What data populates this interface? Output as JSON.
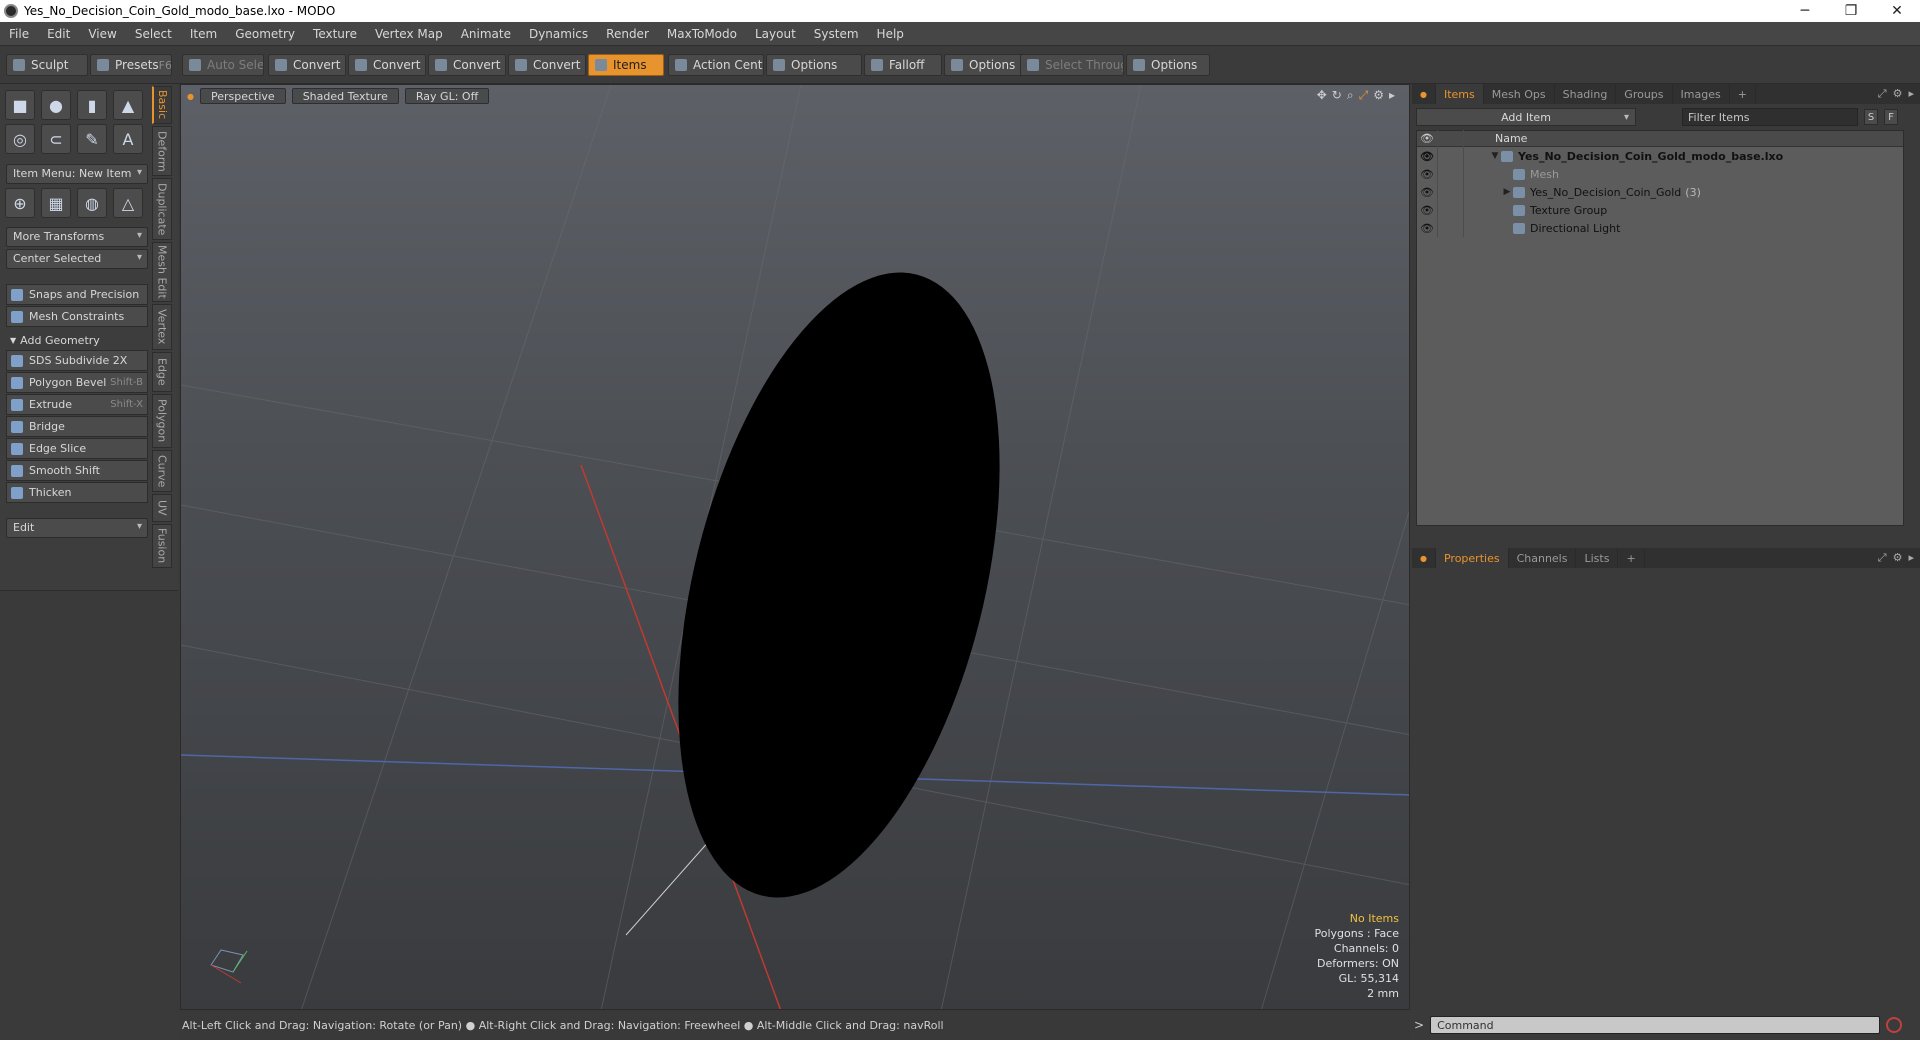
{
  "window": {
    "title": "Yes_No_Decision_Coin_Gold_modo_base.lxo - MODO"
  },
  "menu": [
    "File",
    "Edit",
    "View",
    "Select",
    "Item",
    "Geometry",
    "Texture",
    "Vertex Map",
    "Animate",
    "Dynamics",
    "Render",
    "MaxToModo",
    "Layout",
    "System",
    "Help"
  ],
  "toolbar": {
    "sculpt": "Sculpt",
    "presets": "Presets",
    "presets_key": "F6",
    "auto_select": "Auto Select",
    "convert1": "Convert",
    "convert2": "Convert",
    "convert3": "Convert",
    "convert4": "Convert",
    "items": "Items",
    "action_center": "Action Center",
    "options1": "Options",
    "falloff": "Falloff",
    "options2": "Options",
    "select_through": "Select Through",
    "options3": "Options"
  },
  "left": {
    "item_menu": "Item Menu: New Item",
    "more_transforms": "More Transforms",
    "center_selected": "Center Selected",
    "snaps": "Snaps and Precision",
    "mesh_constraints": "Mesh Constraints",
    "add_geometry": "Add Geometry",
    "tools": [
      {
        "label": "SDS Subdivide 2X",
        "key": ""
      },
      {
        "label": "Polygon Bevel",
        "key": "Shift-B"
      },
      {
        "label": "Extrude",
        "key": "Shift-X"
      },
      {
        "label": "Bridge",
        "key": ""
      },
      {
        "label": "Edge Slice",
        "key": ""
      },
      {
        "label": "Smooth Shift",
        "key": ""
      },
      {
        "label": "Thicken",
        "key": ""
      }
    ],
    "edit": "Edit",
    "vtabs": [
      "Basic",
      "Deform",
      "Duplicate",
      "Mesh Edit",
      "Vertex",
      "Edge",
      "Polygon",
      "Curve",
      "UV",
      "Fusion"
    ]
  },
  "viewport": {
    "view": "Perspective",
    "shading": "Shaded Texture",
    "raygl": "Ray GL: Off",
    "hud": {
      "no_items": "No Items",
      "polygons": "Polygons : Face",
      "channels": "Channels: 0",
      "deformers": "Deformers: ON",
      "gl": "GL: 55,314",
      "scale": "2 mm"
    }
  },
  "status": "Alt-Left Click and Drag: Navigation: Rotate (or Pan) ● Alt-Right Click and Drag: Navigation: Freewheel ● Alt-Middle Click and Drag: navRoll",
  "right": {
    "tabs": [
      "Items",
      "Mesh Ops",
      "Shading",
      "Groups",
      "Images",
      "+"
    ],
    "add_item": "Add Item",
    "filter": "Filter Items",
    "s_btn": "S",
    "f_btn": "F",
    "col_name": "Name",
    "tree": {
      "root": "Yes_No_Decision_Coin_Gold_modo_base.lxo",
      "mesh": "Mesh",
      "coin": "Yes_No_Decision_Coin_Gold",
      "coin_count": "(3)",
      "texture_group": "Texture Group",
      "light": "Directional Light"
    },
    "prop_tabs": [
      "Properties",
      "Channels",
      "Lists",
      "+"
    ],
    "command_placeholder": "Command"
  }
}
